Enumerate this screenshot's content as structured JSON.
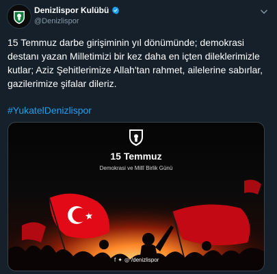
{
  "account": {
    "name": "Denizlispor Kulübü",
    "handle": "@Denizlispor"
  },
  "tweet": {
    "text": "15 Temmuz darbe girişiminin yıl dönümünde; demokrasi destanı yazan Milletimizi bir kez daha en içten dileklerimizle kutlar; Aziz Şehitlerimize Allah'tan rahmet, ailelerine sabırlar, gazilerimize şifalar dileriz.",
    "hashtag": "#YukatelDenizlispor"
  },
  "media": {
    "title": "15 Temmuz",
    "subtitle": "Demokrasi ve Millî Birlik Günü",
    "social_handle": "/denizlispor"
  },
  "colors": {
    "background": "#15202b",
    "link": "#1da1f2",
    "muted": "#8899a6",
    "flag_red": "#e30a17"
  },
  "icons": [
    "club-logo-icon",
    "verified-badge-icon",
    "chevron-down-icon",
    "facebook-icon",
    "twitter-icon",
    "instagram-icon"
  ]
}
